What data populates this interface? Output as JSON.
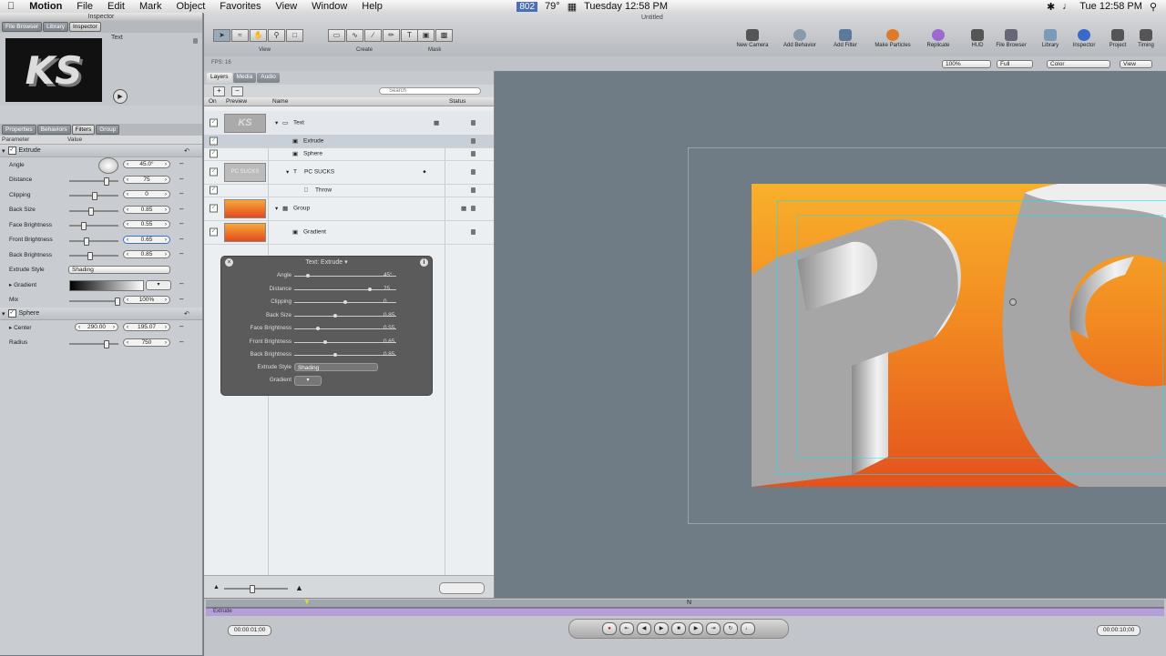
{
  "menubar": {
    "app_name": "Motion",
    "items": [
      "File",
      "Edit",
      "Mark",
      "Object",
      "Favorites",
      "View",
      "Window",
      "Help"
    ],
    "status_value": "802",
    "temperature": "79°",
    "date_time": "Tuesday 12:58 PM",
    "clock": "Tue 12:58 PM"
  },
  "inspector": {
    "title": "Inspector",
    "top_tabs": [
      "File Browser",
      "Library",
      "Inspector"
    ],
    "preview_label": "Text",
    "preview_thumb_text": "KS",
    "tabs": [
      "Properties",
      "Behaviors",
      "Filters",
      "Group"
    ],
    "col_parameter": "Parameter",
    "col_value": "Value",
    "extrude_group": "Extrude",
    "params": [
      {
        "label": "Angle",
        "value": "45.0°"
      },
      {
        "label": "Distance",
        "value": "75"
      },
      {
        "label": "Clipping",
        "value": "0"
      },
      {
        "label": "Back Size",
        "value": "0.85"
      },
      {
        "label": "Face Brightness",
        "value": "0.55"
      },
      {
        "label": "Front Brightness",
        "value": "0.65"
      },
      {
        "label": "Back Brightness",
        "value": "0.85"
      }
    ],
    "extrude_style_label": "Extrude Style",
    "extrude_style_value": "Shading",
    "gradient_label": "Gradient",
    "mix_label": "Mix",
    "mix_value": "100%",
    "sphere_group": "Sphere",
    "center_label": "Center",
    "center_x": "290.00",
    "center_y": "195.07",
    "radius_label": "Radius",
    "radius_value": "750"
  },
  "toolbar": {
    "group_view": "View",
    "group_create": "Create",
    "group_mask": "Mask",
    "right_tools": [
      "New Camera",
      "Add Behavior",
      "Add Filter",
      "Make Particles",
      "Replicate",
      "HUD",
      "File Browser",
      "Library",
      "Inspector",
      "Project",
      "Timing"
    ],
    "fps_label": "FPS: 16",
    "canvas_title": "Untitled",
    "zoom": "100%",
    "resolution": "Full",
    "channels": "Color",
    "view": "View"
  },
  "layers": {
    "tabs": [
      "Layers",
      "Media",
      "Audio"
    ],
    "search_placeholder": "Search",
    "col_on": "On",
    "col_preview": "Preview",
    "col_name": "Name",
    "col_status": "Status",
    "rows": [
      {
        "name": "Text",
        "thumb": "KS"
      },
      {
        "name": "Extrude"
      },
      {
        "name": "Sphere"
      },
      {
        "name": "PC SUCKS",
        "thumb": "PC SUCKS"
      },
      {
        "name": "Throw"
      },
      {
        "name": "Group"
      },
      {
        "name": "Gradient"
      }
    ]
  },
  "hud": {
    "title": "Text: Extrude",
    "rows": [
      {
        "label": "Angle",
        "value": "45°",
        "pos": 0.12
      },
      {
        "label": "Distance",
        "value": "75",
        "pos": 0.75
      },
      {
        "label": "Clipping",
        "value": "0",
        "pos": 0.5
      },
      {
        "label": "Back Size",
        "value": "0.85",
        "pos": 0.4
      },
      {
        "label": "Face Brightness",
        "value": "0.55",
        "pos": 0.22
      },
      {
        "label": "Front Brightness",
        "value": "0.65",
        "pos": 0.3
      },
      {
        "label": "Back Brightness",
        "value": "0.85",
        "pos": 0.4
      }
    ],
    "extrude_style_label": "Extrude Style",
    "extrude_style_value": "Shading",
    "gradient_label": "Gradient"
  },
  "canvas": {
    "text": "PC"
  },
  "timeline": {
    "bar_label": "Extrude",
    "current_time": "00:00:01;00",
    "duration": "00:00:10;00"
  }
}
